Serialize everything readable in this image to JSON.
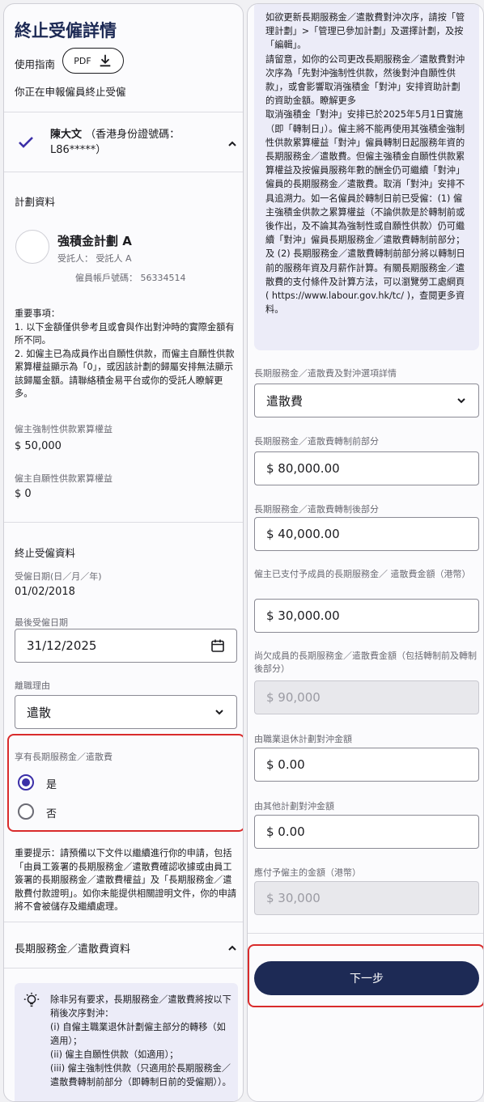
{
  "left": {
    "title": "終止受僱詳情",
    "guide_label": "使用指南",
    "pdf_label": "PDF",
    "declaring_text": "你正在申報僱員終止受僱",
    "employee_name": "陳大文",
    "employee_id": "（香港身份證號碼： L86*****）",
    "plan_section_label": "計劃資料",
    "plan_name": "強積金計劃 A",
    "trustee": "受託人： 受託人 A",
    "member_account": "僱員帳戶號碼： 56334514",
    "notes": [
      "重要事項：",
      "1. 以下金額僅供參考且或會與作出對沖時的實際金額有所不同。",
      "2. 如僱主已為成員作出自願性供款，而僱主自願性供款累算權益顯示為「0」，或因該計劃的歸屬安排無法顯示該歸屬金額。請聯絡積金易平台或你的受託人瞭解更多。"
    ],
    "mandatory_label": "僱主強制性供款累算權益",
    "mandatory_value": "$ 50,000",
    "voluntary_label": "僱主自願性供款累算權益",
    "voluntary_value": "$ 0",
    "termination_section_label": "終止受僱資料",
    "employment_date_label": "受僱日期(日／月／年)",
    "employment_date_value": "01/02/2018",
    "last_date_label": "最後受僱日期",
    "last_date_value": "31/12/2025",
    "reason_label": "離職理由",
    "reason_value": "遣散",
    "entitled_label": "享有長期服務金／遣散費",
    "radio_yes": "是",
    "radio_no": "否",
    "reminder": "重要提示：請預備以下文件以繼續進行你的申請，包括「由員工簽署的長期服務金／遣散費確認收據或由員工簽署的長期服務金／遣散費權益」及「長期服務金／遣散費付款證明」。如你未能提供相關證明文件，你的申請將不會被儲存及繼續處理。",
    "lsp_section_label": "長期服務金／遣散費資料",
    "info_lines": [
      "除非另有要求，長期服務金／遣散費將按以下稍後次序對沖：",
      "(i) 自僱主職業退休計劃僱主部分的轉移（如適用）；",
      "(ii) 僱主自願性供款（如適用）；",
      "(iii) 僱主強制性供款（只適用於長期服務金／遣散費轉制前部分（即轉制日前的受僱期））。"
    ]
  },
  "right": {
    "top_notice": "如欲更新長期服務金／遣散費對沖次序，請按「管理計劃」>「管理已參加計劃」及選擇計劃，及按「編輯」。\n請留意，如你的公司更改長期服務金／遣散費對沖次序為「先對沖強制性供款，然後對沖自願性供款」，或會影響取消強積金「對沖」安排資助計劃的資助金額。瞭解更多\n取消強積金「對沖」安排已於2025年5月1日實施（即「轉制日」）。僱主將不能再使用其強積金強制性供款累算權益「對沖」僱員轉制日起服務年資的長期服務金／遣散費。但僱主強積金自願性供款累算權益及按僱員服務年數的酬金仍可繼續「對沖」僱員的長期服務金／遣散費。取消「對沖」安排不具追溯力。如一名僱員於轉制日前已受僱：(1) 僱主強積金供款之累算權益（不論供款是於轉制前或後作出，及不論其為強制性或自願性供款）仍可繼續「對沖」僱員長期服務金／遣散費轉制前部分；及 (2) 長期服務金／遣散費轉制前部分將以轉制日前的服務年資及月薪作計算。有關長期服務金／遣散費的支付條件及計算方法，可以瀏覽勞工處網頁( https://www.labour.gov.hk/tc/ )，查閱更多資料。",
    "option_label": "長期服務金／遣散費及對沖選項詳情",
    "option_value": "遣散費",
    "pre_label": "長期服務金／遣散費轉制前部分",
    "pre_value": "$ 80,000.00",
    "post_label": "長期服務金／遣散費轉制後部分",
    "post_value": "$ 40,000.00",
    "paid_label": "僱主已支付予成員的長期服務金／ 遣散費金額（港幣）",
    "paid_value": "$ 30,000.00",
    "owed_label": "尚欠成員的長期服務金／遣散費金額（包括轉制前及轉制後部分）",
    "owed_value": "$ 90,000",
    "orso_label": "由職業退休計劃對沖金額",
    "orso_value": "$ 0.00",
    "other_label": "由其他計劃對沖金額",
    "other_value": "$ 0.00",
    "payable_label": "應付予僱主的金額（港幣）",
    "payable_value": "$ 30,000",
    "next_label": "下一步"
  }
}
